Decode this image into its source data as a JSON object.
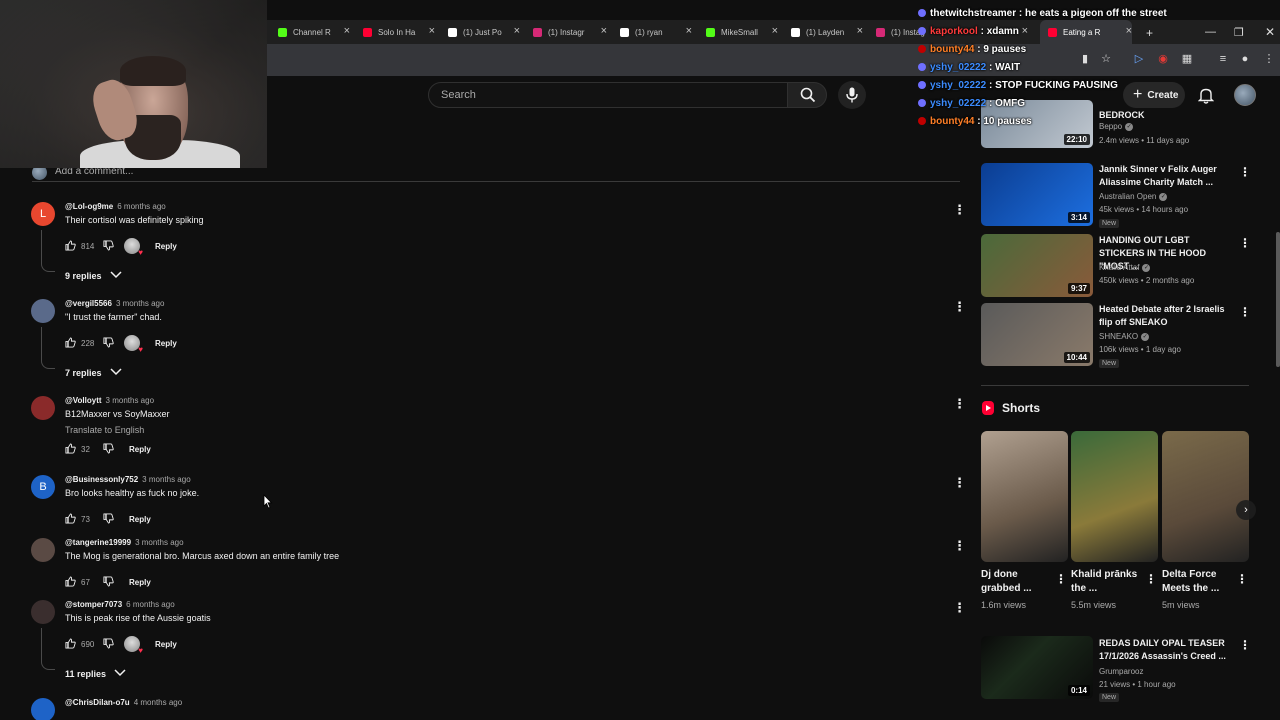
{
  "tabs": [
    {
      "label": "Channel R",
      "color": "#53fc18"
    },
    {
      "label": "Solo In Ha",
      "color": "#ff0033"
    },
    {
      "label": "(1) Just Po",
      "color": "#ffffff"
    },
    {
      "label": "(1) Instagr",
      "color": "#d62976"
    },
    {
      "label": "(1) ryan",
      "color": "#ffffff"
    },
    {
      "label": "MikeSmall",
      "color": "#53fc18"
    },
    {
      "label": "(1) Layden",
      "color": "#ffffff"
    },
    {
      "label": "(1) Instag",
      "color": "#d62976"
    },
    {
      "label": "Eating a R",
      "color": "#ff0033"
    }
  ],
  "search": {
    "placeholder": "Search"
  },
  "header": {
    "create_label": "Create"
  },
  "chat": [
    {
      "user": "thetwitchstreamer",
      "msg": "he eats a pigeon off the street",
      "color": "#ffffff",
      "badge": "#6f6fff"
    },
    {
      "user": "kaporkool",
      "msg": "xdamn",
      "color": "#ff3b3b",
      "badge": "#6f6fff"
    },
    {
      "user": "bounty44",
      "msg": "9 pauses",
      "color": "#ff7f27",
      "badge": "#c00000"
    },
    {
      "user": "yshy_02222",
      "msg": "WAIT",
      "color": "#3c8cff",
      "badge": "#6f6fff"
    },
    {
      "user": "yshy_02222",
      "msg": "STOP FUCKING PAUSING",
      "color": "#3c8cff",
      "badge": "#6f6fff"
    },
    {
      "user": "yshy_02222",
      "msg": "OMFG",
      "color": "#3c8cff",
      "badge": "#6f6fff"
    },
    {
      "user": "bounty44",
      "msg": "10 pauses",
      "color": "#ff7f27",
      "badge": "#c00000"
    }
  ],
  "add_comment": {
    "placeholder": "Add a comment..."
  },
  "comments": [
    {
      "avatar_letter": "L",
      "avatar_color": "#e8472f",
      "author": "@Lol-og9me",
      "time": "6 months ago",
      "text": "Their cortisol was definitely spiking",
      "likes": "814",
      "reply_label": "Reply",
      "replies_label": "9 replies"
    },
    {
      "avatar_letter": "",
      "avatar_color": "#5a6a8a",
      "author": "@vergil5566",
      "time": "3 months ago",
      "text": "\"I trust the farmer\" chad.",
      "likes": "228",
      "reply_label": "Reply",
      "replies_label": "7 replies"
    },
    {
      "avatar_letter": "",
      "avatar_color": "#8a2a2a",
      "author": "@Volloytt",
      "time": "3 months ago",
      "text": "B12Maxxer vs SoyMaxxer",
      "translate_label": "Translate to English",
      "likes": "32",
      "reply_label": "Reply"
    },
    {
      "avatar_letter": "B",
      "avatar_color": "#1e63c7",
      "author": "@Businessonly752",
      "time": "3 months ago",
      "text": "Bro looks healthy as fuck no joke.",
      "likes": "73",
      "reply_label": "Reply"
    },
    {
      "avatar_letter": "",
      "avatar_color": "#5a4a44",
      "author": "@tangerine19999",
      "time": "3 months ago",
      "text": "The Mog is generational bro. Marcus axed down an entire family tree",
      "likes": "67",
      "reply_label": "Reply"
    },
    {
      "avatar_letter": "",
      "avatar_color": "#3a2e2e",
      "author": "@stomper7073",
      "time": "6 months ago",
      "text": "This is peak rise of the Aussie goatis",
      "likes": "690",
      "reply_label": "Reply",
      "replies_label": "11 replies"
    },
    {
      "avatar_letter": "",
      "avatar_color": "#1e63c7",
      "author": "@ChrisDilan-o7u",
      "time": "4 months ago"
    }
  ],
  "recommended": [
    {
      "title": "BEDROCK",
      "channel": "Beppo",
      "meta": "2.4m views • 11 days ago",
      "duration": "22:10",
      "colors": [
        "#7a8a9a",
        "#c2c9d1"
      ]
    },
    {
      "title": "Jannik Sinner v Felix Auger Aliassime Charity Match ...",
      "channel": "Australian Open",
      "meta": "45k views • 14 hours ago",
      "duration": "3:14",
      "new": "New",
      "colors": [
        "#0b3d91",
        "#1d6fe0"
      ]
    },
    {
      "title": "HANDING OUT LGBT STICKERS IN THE HOOD \"MOST ...",
      "channel": "Khalid Attaf",
      "meta": "450k views • 2 months ago",
      "duration": "9:37",
      "colors": [
        "#4a6a3a",
        "#8a5a3a"
      ]
    },
    {
      "title": "Heated Debate after 2 Israelis flip off SNEAKO",
      "channel": "SHNEAKO",
      "meta": "106k views • 1 day ago",
      "duration": "10:44",
      "new": "New",
      "colors": [
        "#5a5a5a",
        "#8a7a6a"
      ]
    }
  ],
  "shorts": {
    "heading": "Shorts",
    "items": [
      {
        "title": "Dj done grabbed ...",
        "views": "1.6m views",
        "colors": [
          "#6a5a4a",
          "#b0a090"
        ]
      },
      {
        "title": "Khalid prānks the ...",
        "views": "5.5m views",
        "colors": [
          "#8a7a3a",
          "#3a6a3a"
        ]
      },
      {
        "title": "Delta Force Meets the ...",
        "views": "5m views",
        "colors": [
          "#5a4a3a",
          "#7a6a4a"
        ]
      }
    ]
  },
  "rec_bottom": {
    "title": "REDAS DAILY OPAL TEASER 17/1/2026 Assassin's Creed ...",
    "channel": "Grumparooz",
    "meta": "21 views • 1 hour ago",
    "duration": "0:14",
    "new": "New"
  }
}
